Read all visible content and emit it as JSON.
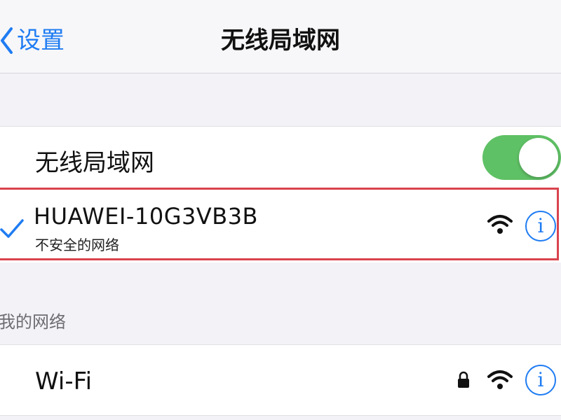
{
  "nav": {
    "back_label": "设置",
    "title": "无线局域网"
  },
  "wifi_toggle": {
    "label": "无线局域网",
    "state": "on",
    "color": "#5fc165"
  },
  "connected_network": {
    "name": "HUAWEI-10G3VB3B",
    "subtitle": "不安全的网络",
    "checked": true,
    "highlight_color": "#d9434d",
    "icons": [
      "checkmark-icon",
      "wifi-signal-icon",
      "info-icon"
    ]
  },
  "my_networks": {
    "header": "我的网络",
    "items": [
      {
        "name": "Wi-Fi",
        "locked": true,
        "icons": [
          "lock-icon",
          "wifi-signal-icon",
          "info-icon"
        ]
      }
    ]
  },
  "colors": {
    "accent": "#1f7cf2",
    "background": "#f2f2f7"
  }
}
